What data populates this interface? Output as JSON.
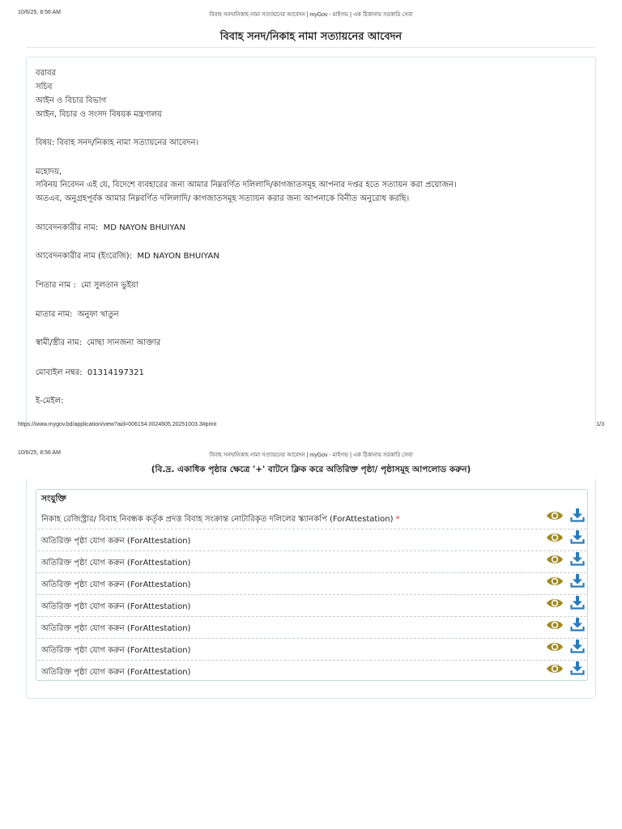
{
  "print": {
    "timestamp": "10/6/25, 8:56 AM",
    "page_title": "বিবাহ সনদ/নিকাহ নামা সত্যায়নের আবেদন | myGov - মাইগভ | এক ঠিকানায় সরকারি সেবা",
    "url": "https://www.mygov.bd/application/view?aid=006154.0024605.20251003.3#print",
    "page_number": "1/3"
  },
  "title": "বিবাহ সনদ/নিকাহ নামা সত্যায়নের আবেদন",
  "letter": {
    "to_line": "বরাবর",
    "recipient": "সচিব",
    "division": "আইন ও বিচার বিভাগ",
    "ministry": "আইন, বিচার ও সংসদ বিষয়ক মন্ত্রণালয়",
    "subject": "বিষয়: বিবাহ সনদ/নিকাহ নামা সত্যায়নের আবেদন।",
    "salutation": "মহোদয়,",
    "body_1": "সবিনয় নিবেদন এই যে, বিদেশে ব্যবহারের জন্য আমার নিম্নবর্ণিত দলিলাদি/কাগজাতসমূহ আপনার দপ্তর হতে সত্যায়ন করা প্রয়োজন।",
    "body_2": "অতএব, অনুগ্রহপূর্বক আমার নিম্নবর্ণিত দলিলাদি/ কাগজাতসমূহ সত্যায়ন করার জন্য আপনাকে বিনীত অনুরোধ করছি।",
    "fields": [
      {
        "label": "আবেদনকারীর নাম:",
        "value": "MD NAYON BHUIYAN"
      },
      {
        "label": "আবেদনকারীর নাম (ইংরেজি):",
        "value": "MD NAYON BHUIYAN"
      },
      {
        "label": "পিতার নাম :",
        "value": "মো সুলতান ভুইয়া"
      },
      {
        "label": "মাতার নাম:",
        "value": "অনুফা খাতুন"
      },
      {
        "label": "স্বামী/স্ত্রীর নাম:",
        "value": "মোছা সানজনা আক্তার"
      },
      {
        "label": "মোবাইল নম্বর:",
        "value": "01314197321"
      },
      {
        "label": "ই-মেইল:",
        "value": ""
      }
    ]
  },
  "note": "(বি.দ্র. একাধিক পৃষ্ঠার ক্ষেত্রে '+' বাটনে ক্লিক করে অতিরিক্ত পৃষ্ঠা/ পৃষ্ঠাসমূহ আপলোড করুন)",
  "attachments": {
    "heading": "সংযুক্তি",
    "required_mark": "*",
    "icon_color_view": "#a08a1f",
    "icon_color_download": "#2b7bb9",
    "items": [
      {
        "label": "নিকাহ রেজিস্ট্রার/ বিবাহ নিবন্ধক কর্তৃক প্রদত্ত বিবাহ সংক্রান্ত নোটারিকৃত দলিলের স্ক্যানকপি (ForAttestation)"
      },
      {
        "label": "অতিরিক্ত পৃষ্ঠা যোগ করুন (ForAttestation)"
      },
      {
        "label": "অতিরিক্ত পৃষ্ঠা যোগ করুন (ForAttestation)"
      },
      {
        "label": "অতিরিক্ত পৃষ্ঠা যোগ করুন (ForAttestation)"
      },
      {
        "label": "অতিরিক্ত পৃষ্ঠা যোগ করুন (ForAttestation)"
      },
      {
        "label": "অতিরিক্ত পৃষ্ঠা যোগ করুন (ForAttestation)"
      },
      {
        "label": "অতিরিক্ত পৃষ্ঠা যোগ করুন (ForAttestation)"
      },
      {
        "label": "অতিরিক্ত পৃষ্ঠা যোগ করুন (ForAttestation)"
      }
    ]
  }
}
